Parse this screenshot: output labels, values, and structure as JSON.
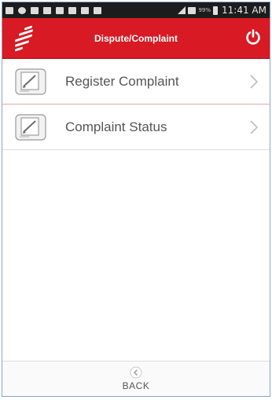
{
  "status_bar": {
    "time": "11:41 AM",
    "battery_text": "99%"
  },
  "header": {
    "title": "Dispute/Complaint",
    "accent_color": "#d71a24"
  },
  "menu": {
    "items": [
      {
        "label": "Register Complaint",
        "icon": "document-pen-icon"
      },
      {
        "label": "Complaint Status",
        "icon": "document-pen-icon"
      }
    ]
  },
  "footer": {
    "back_label": "BACK"
  }
}
